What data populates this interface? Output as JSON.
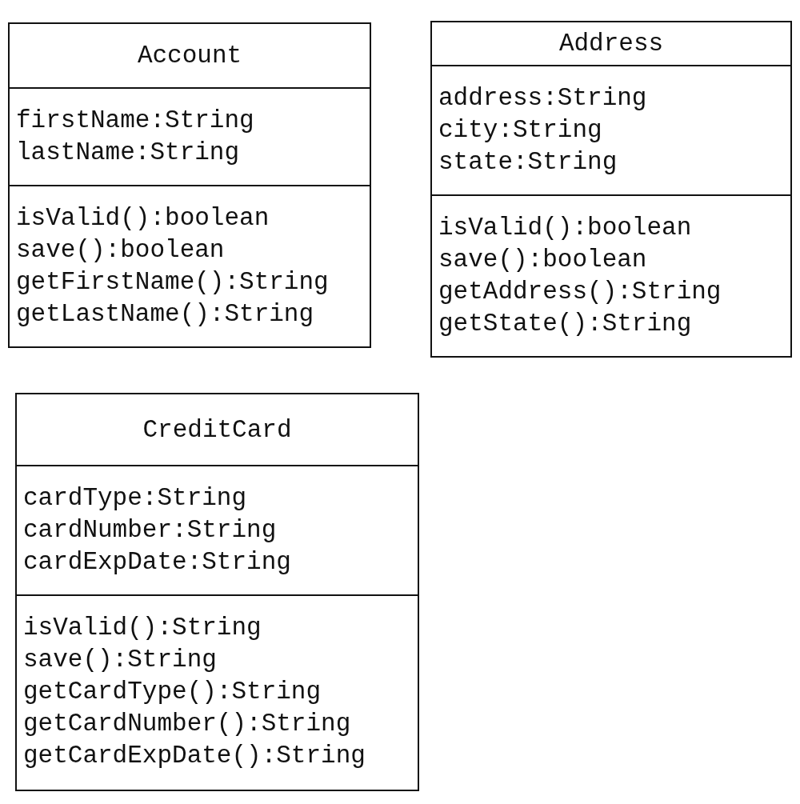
{
  "classes": [
    {
      "name": "Account",
      "attributes": [
        "firstName:String",
        "lastName:String"
      ],
      "methods": [
        "isValid():boolean",
        "save():boolean",
        "getFirstName():String",
        "getLastName():String"
      ]
    },
    {
      "name": "Address",
      "attributes": [
        "address:String",
        "city:String",
        "state:String"
      ],
      "methods": [
        "isValid():boolean",
        "save():boolean",
        "getAddress():String",
        "getState():String"
      ]
    },
    {
      "name": "CreditCard",
      "attributes": [
        "cardType:String",
        "cardNumber:String",
        "cardExpDate:String"
      ],
      "methods": [
        "isValid():String",
        "save():String",
        "getCardType():String",
        "getCardNumber():String",
        "getCardExpDate():String"
      ]
    }
  ]
}
